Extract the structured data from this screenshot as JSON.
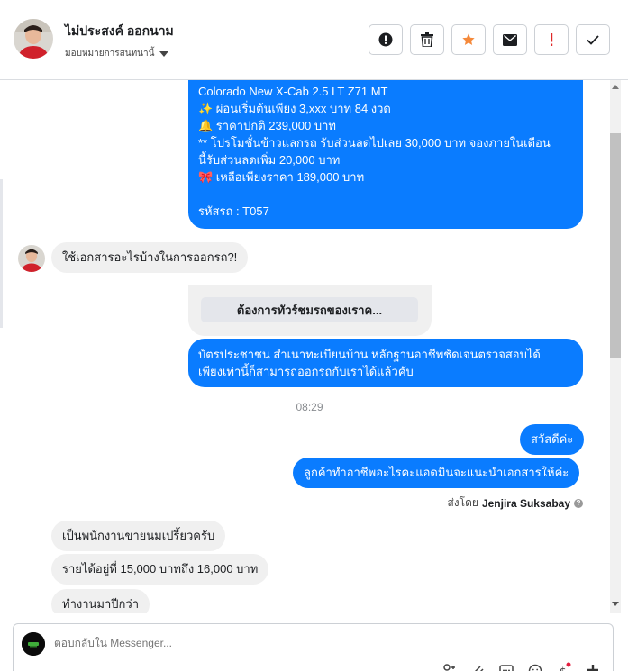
{
  "header": {
    "contact_name": "ไม่ประสงค์ ออกนาม",
    "assign_label": "มอบหมายการสนทนานี้",
    "actions": [
      {
        "name": "report-button",
        "icon": "alert-circle-icon"
      },
      {
        "name": "delete-button",
        "icon": "trash-icon"
      },
      {
        "name": "star-button",
        "icon": "star-icon"
      },
      {
        "name": "mark-unread-button",
        "icon": "envelope-icon"
      },
      {
        "name": "spam-button",
        "icon": "exclamation-icon"
      },
      {
        "name": "done-button",
        "icon": "check-icon"
      }
    ],
    "colors": {
      "star": "#f5893a",
      "alert": "#e02828"
    }
  },
  "messages": {
    "promo": {
      "line1": "Colorado New X-Cab 2.5 LT Z71 MT",
      "line2": "✨  ผ่อนเริ่มต้นเพียง 3,xxx บาท 84 งวด",
      "line3": "🔔 ราคาปกติ 239,000 บาท",
      "line4": "** โปรโมชั่นข้าวแลกรถ รับส่วนลดไปเลย 30,000 บาท จองภายในเดือน",
      "line5": "นี้รับส่วนลดเพิ่ม 20,000 บาท",
      "line6": "🎀  เหลือเพียงราคา 189,000 บาท",
      "code": " รหัสรถ : T057"
    },
    "q1": "ใช้เอกสารอะไรบ้างในการออกรถ?!",
    "card_button": "ต้องการทัวร์ชมรถของเราค...",
    "reply1_line1": "บัตรประชาชน สำเนาทะเบียนบ้าน หลักฐานอาชีพชัดเจนตรวจสอบได้",
    "reply1_line2": "เพียงเท่านี้ก็สามารถออกรถกับเราได้แล้วคับ",
    "timestamp": "08:29",
    "greet": "สวัสดีค่ะ",
    "ask_job": "ลูกค้าทำอาชีพอะไรคะแอดมินจะแนะนำเอกสารให้ค่ะ",
    "sent_by_prefix": "ส่งโดย",
    "sent_by_name": "Jenjira Suksabay",
    "in1": "เป็นพนักงานขายนมเปรี้ยวครับ",
    "in2": "รายได้อยู่ที่ 15,000 บาทถึง 16,000 บาท",
    "in3": "ทำงานมาปีกว่า"
  },
  "composer": {
    "placeholder": "ตอบกลับใน Messenger..."
  },
  "colors": {
    "outgoing_bubble": "#0a7cff",
    "incoming_bubble": "#f0f0f0"
  }
}
